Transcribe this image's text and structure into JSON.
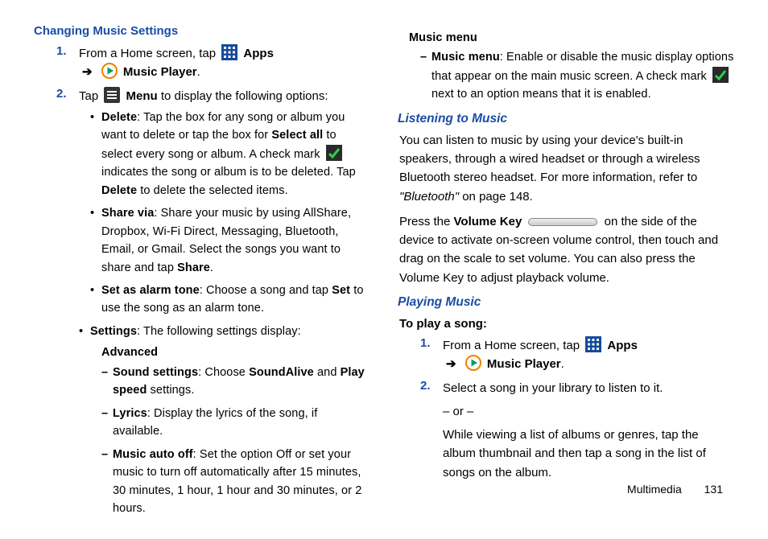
{
  "left": {
    "heading": "Changing Music Settings",
    "step1_a": "From a Home screen, tap ",
    "apps_label": "Apps",
    "music_player_label": "Music Player",
    "period": ".",
    "step2_a": "Tap ",
    "menu_label": "Menu",
    "step2_b": " to display the following options:",
    "bul_delete_h": "Delete",
    "bul_delete_t1": ": Tap the box for any song or album you want to delete or tap the box for ",
    "bul_delete_selall": "Select all",
    "bul_delete_t2": " to select every song or album. A check mark ",
    "bul_delete_t3": " indicates the song or album is to be deleted. Tap ",
    "bul_delete_del2": "Delete",
    "bul_delete_t4": " to delete the selected items.",
    "bul_share_h": "Share via",
    "bul_share_t": ": Share your music by using AllShare, Dropbox, Wi-Fi Direct, Messaging, Bluetooth, Email, or Gmail. Select the songs you want to share and tap ",
    "bul_share_b": "Share",
    "bul_alarm_h": "Set as alarm tone",
    "bul_alarm_t1": ": Choose a song and tap ",
    "bul_alarm_set": "Set",
    "bul_alarm_t2": " to use the song as an alarm tone.",
    "bul_settings_h": "Settings",
    "bul_settings_t": ": The following settings display:",
    "adv_label": "Advanced",
    "d1_h": "Sound settings",
    "d1_t1": ": Choose ",
    "d1_b1": "SoundAlive",
    "d1_and": " and ",
    "d1_b2": "Play speed",
    "d1_t2": " settings.",
    "d2_h": "Lyrics",
    "d2_t": ": Display the lyrics of the song, if available.",
    "d3_h": "Music auto off",
    "d3_t": ": Set the option Off or set your music to turn off automatically after 15 minutes, 30 minutes, 1 hour, 1 hour and 30 minutes, or 2 hours."
  },
  "right": {
    "mm_head": "Music menu",
    "mm_h": "Music menu",
    "mm_t1": ": Enable or disable the music display options that appear on the main music screen. A check mark ",
    "mm_t2": " next to an option means that it is enabled.",
    "listen_head": "Listening to Music",
    "listen_p1a": "You can listen to music by using your device's built-in speakers, through a wired headset or through a wireless Bluetooth stereo headset. For more information, refer to ",
    "listen_ref": "\"Bluetooth\"",
    "listen_p1b": " on page 148.",
    "listen_p2a": "Press the ",
    "listen_vk": "Volume Key",
    "listen_p2b": " on the side of the device to activate on-screen volume control, then touch and drag on the scale to set volume. You can also press the Volume Key to adjust playback volume.",
    "play_head": "Playing Music",
    "play_sub": "To play a song:",
    "step1_a": "From a Home screen, tap ",
    "apps_label": "Apps",
    "music_player_label": "Music Player",
    "period": ".",
    "step2_a": "Select a song in your library to listen to it.",
    "or": "– or –",
    "step2_b": "While viewing a list of albums or genres, tap the album thumbnail and then tap a song in the list of songs on the album."
  },
  "footer": {
    "section": "Multimedia",
    "page": "131"
  },
  "nums": {
    "n1": "1.",
    "n2": "2."
  },
  "arrow": "➔"
}
